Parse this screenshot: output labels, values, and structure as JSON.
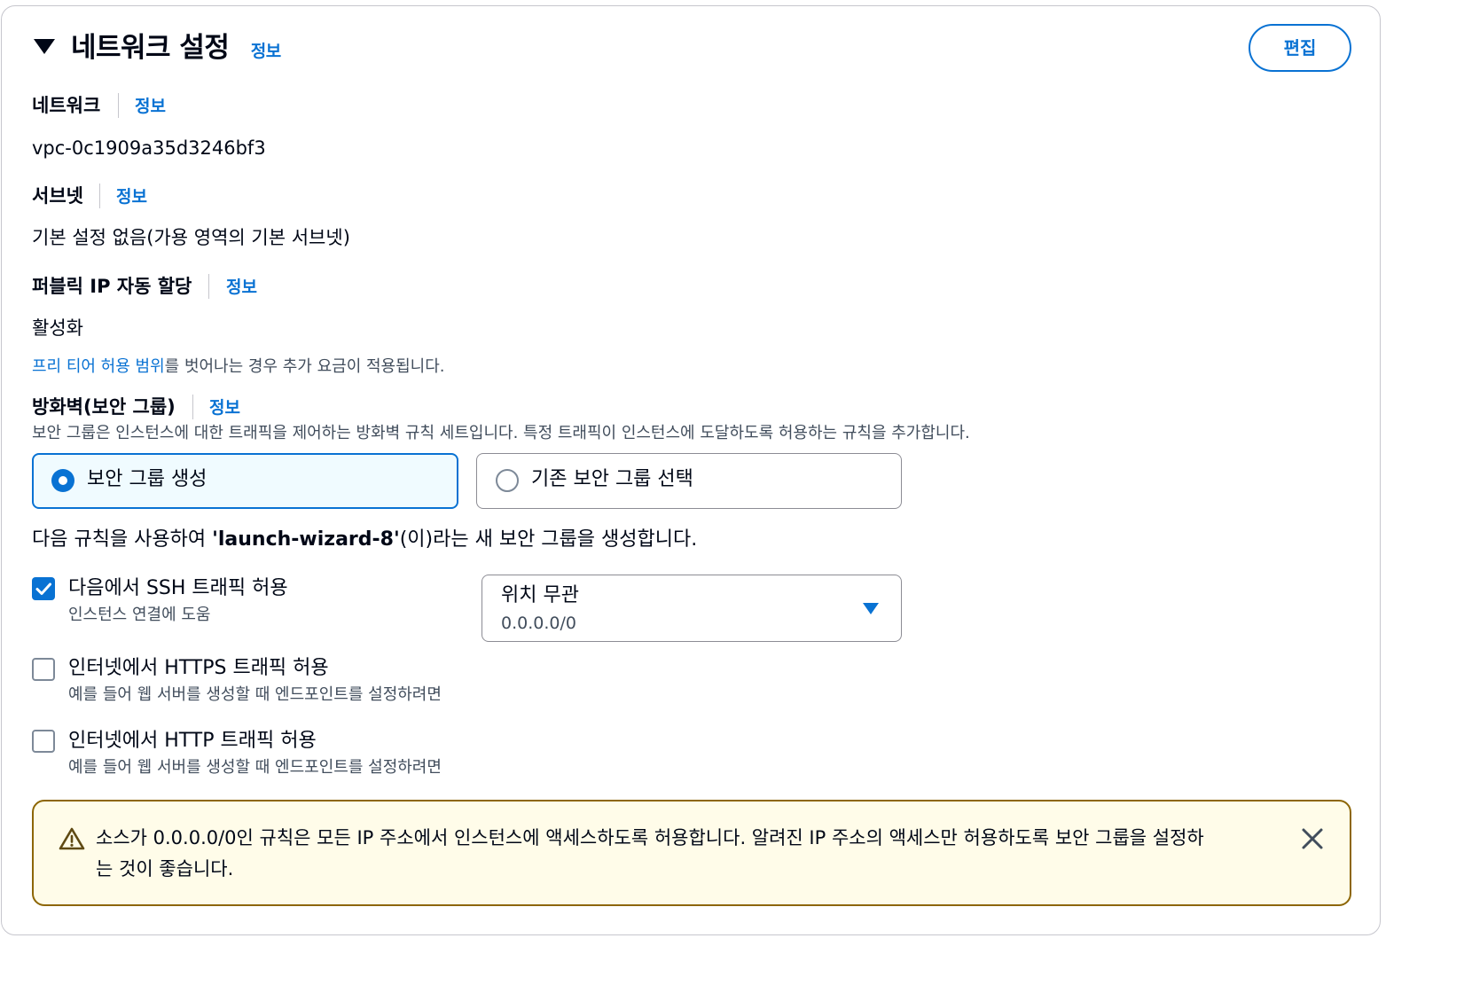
{
  "header": {
    "title": "네트워크 설정",
    "info": "정보",
    "edit_label": "편집"
  },
  "network": {
    "label": "네트워크",
    "info": "정보",
    "value": "vpc-0c1909a35d3246bf3"
  },
  "subnet": {
    "label": "서브넷",
    "info": "정보",
    "value": "기본 설정 없음(가용 영역의 기본 서브넷)"
  },
  "public_ip": {
    "label": "퍼블릭 IP 자동 할당",
    "info": "정보",
    "value": "활성화"
  },
  "free_tier": {
    "link": "프리 티어 허용 범위",
    "rest": "를 벗어나는 경우 추가 요금이 적용됩니다."
  },
  "firewall": {
    "label": "방화벽(보안 그룹)",
    "info": "정보",
    "description": "보안 그룹은 인스턴스에 대한 트래픽을 제어하는 방화벽 규칙 세트입니다. 특정 트래픽이 인스턴스에 도달하도록 허용하는 규칙을 추가합니다.",
    "options": [
      {
        "label": "보안 그룹 생성",
        "selected": true
      },
      {
        "label": "기존 보안 그룹 선택",
        "selected": false
      }
    ],
    "rule_text_prefix": "다음 규칙을 사용하여 ",
    "rule_text_name": "'launch-wizard-8'",
    "rule_text_suffix": "(이)라는 새 보안 그룹을 생성합니다."
  },
  "rules": {
    "ssh": {
      "label": "다음에서 SSH 트래픽 허용",
      "desc": "인스턴스 연결에 도움",
      "checked": true
    },
    "ssh_source": {
      "label": "위치 무관",
      "value": "0.0.0.0/0"
    },
    "https": {
      "label": "인터넷에서 HTTPS 트래픽 허용",
      "desc": "예를 들어 웹 서버를 생성할 때 엔드포인트를 설정하려면",
      "checked": false
    },
    "http": {
      "label": "인터넷에서 HTTP 트래픽 허용",
      "desc": "예를 들어 웹 서버를 생성할 때 엔드포인트를 설정하려면",
      "checked": false
    }
  },
  "warning": {
    "line1": "소스가 0.0.0.0/0인 규칙은 모든 IP 주소에서 인스턴스에 액세스하도록 허용합니다. 알려진 IP 주소의 액세스만 허용하도록 보안 그룹을 설정하",
    "line2": "는 것이 좋습니다."
  },
  "colors": {
    "accent": "#0972d3",
    "warning_border": "#8d6605",
    "warning_bg": "#fffce9",
    "selected_bg": "#f0fbff"
  }
}
